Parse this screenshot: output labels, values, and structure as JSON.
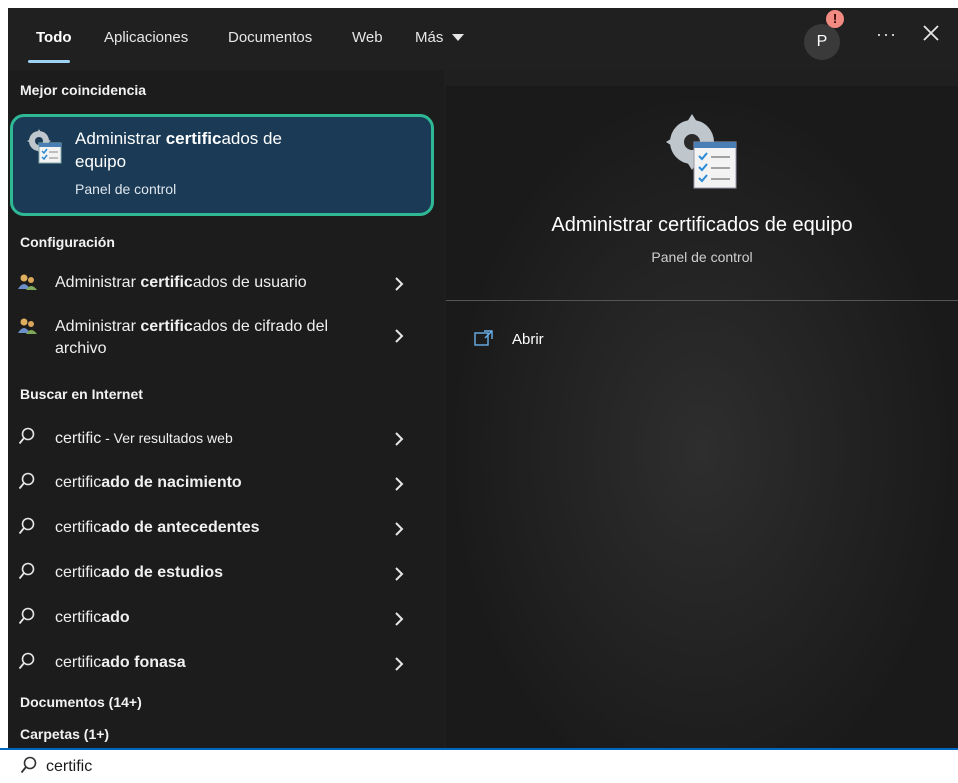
{
  "tabs": [
    {
      "label": "Todo",
      "active": true
    },
    {
      "label": "Aplicaciones"
    },
    {
      "label": "Documentos"
    },
    {
      "label": "Web"
    },
    {
      "label": "Más"
    }
  ],
  "user": {
    "avatar_letter": "P",
    "alert": "!"
  },
  "sections": {
    "best_match": "Mejor coincidencia",
    "settings": "Configuración",
    "web_search": "Buscar en Internet",
    "documents": "Documentos (14+)",
    "folders": "Carpetas (1+)"
  },
  "best_match": {
    "title_pre": "Administrar ",
    "title_bold": "certific",
    "title_post": "ados de equipo",
    "subtitle": "Panel de control"
  },
  "settings_items": [
    {
      "pre": "Administrar ",
      "bold": "certific",
      "post": "ados de usuario"
    },
    {
      "pre": "Administrar ",
      "bold": "certific",
      "post": "ados de cifrado del archivo"
    }
  ],
  "web_items": [
    {
      "text": "certific",
      "suffix": " - Ver resultados web"
    },
    {
      "pre": "certific",
      "bold": "ado de nacimiento"
    },
    {
      "pre": "certific",
      "bold": "ado de antecedentes"
    },
    {
      "pre": "certific",
      "bold": "ado de estudios"
    },
    {
      "pre": "certific",
      "bold": "ado"
    },
    {
      "pre": "certific",
      "bold": "ado fonasa"
    }
  ],
  "preview": {
    "title": "Administrar certificados de equipo",
    "subtitle": "Panel de control",
    "open_label": "Abrir"
  },
  "search": {
    "query": "certific"
  },
  "colors": {
    "accent": "#2fb894",
    "selection": "#1a3a55",
    "underline": "#9fd3f5"
  }
}
